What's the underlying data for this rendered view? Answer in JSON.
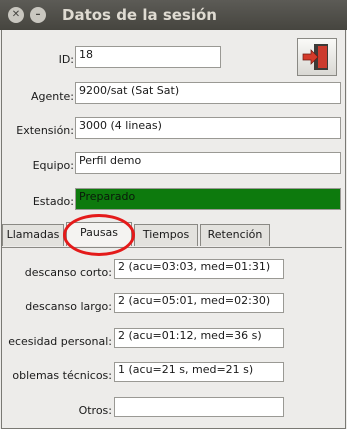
{
  "window": {
    "title": "Datos de la sesión"
  },
  "fields": {
    "id": {
      "label": "ID:",
      "value": "18"
    },
    "agente": {
      "label": "Agente:",
      "value": "9200/sat (Sat Sat)"
    },
    "extension": {
      "label": "Extensión:",
      "value": "3000 (4 lineas)"
    },
    "equipo": {
      "label": "Equipo:",
      "value": "Perfil demo"
    },
    "estado": {
      "label": "Estado:",
      "value": "Preparado"
    }
  },
  "tabs": [
    {
      "label": "Llamadas"
    },
    {
      "label": "Pausas",
      "active": true
    },
    {
      "label": "Tiempos"
    },
    {
      "label": "Retención"
    }
  ],
  "pausas": [
    {
      "label": "descanso corto:",
      "value": "2 (acu=03:03, med=01:31)"
    },
    {
      "label": "descanso largo:",
      "value": "2 (acu=05:01, med=02:30)"
    },
    {
      "label": "ecesidad personal:",
      "value": "2 (acu=01:12, med=36 s)"
    },
    {
      "label": "oblemas técnicos:",
      "value": "1 (acu=21 s, med=21 s)"
    },
    {
      "label": "Otros:",
      "value": ""
    }
  ],
  "colors": {
    "estado_ready": "#0d7a0d",
    "annotation": "#e41a1a"
  },
  "icons": {
    "exit_button": "exit-door-arrow-icon"
  }
}
